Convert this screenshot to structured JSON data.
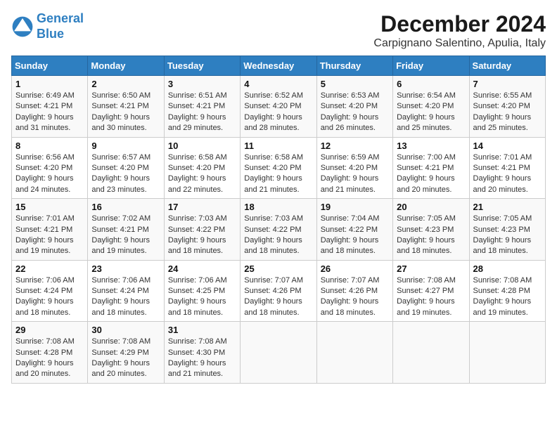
{
  "logo": {
    "line1": "General",
    "line2": "Blue"
  },
  "title": "December 2024",
  "subtitle": "Carpignano Salentino, Apulia, Italy",
  "weekdays": [
    "Sunday",
    "Monday",
    "Tuesday",
    "Wednesday",
    "Thursday",
    "Friday",
    "Saturday"
  ],
  "weeks": [
    [
      {
        "day": 1,
        "rise": "6:49 AM",
        "set": "4:21 PM",
        "daylight": "9 hours and 31 minutes."
      },
      {
        "day": 2,
        "rise": "6:50 AM",
        "set": "4:21 PM",
        "daylight": "9 hours and 30 minutes."
      },
      {
        "day": 3,
        "rise": "6:51 AM",
        "set": "4:21 PM",
        "daylight": "9 hours and 29 minutes."
      },
      {
        "day": 4,
        "rise": "6:52 AM",
        "set": "4:20 PM",
        "daylight": "9 hours and 28 minutes."
      },
      {
        "day": 5,
        "rise": "6:53 AM",
        "set": "4:20 PM",
        "daylight": "9 hours and 26 minutes."
      },
      {
        "day": 6,
        "rise": "6:54 AM",
        "set": "4:20 PM",
        "daylight": "9 hours and 25 minutes."
      },
      {
        "day": 7,
        "rise": "6:55 AM",
        "set": "4:20 PM",
        "daylight": "9 hours and 25 minutes."
      }
    ],
    [
      {
        "day": 8,
        "rise": "6:56 AM",
        "set": "4:20 PM",
        "daylight": "9 hours and 24 minutes."
      },
      {
        "day": 9,
        "rise": "6:57 AM",
        "set": "4:20 PM",
        "daylight": "9 hours and 23 minutes."
      },
      {
        "day": 10,
        "rise": "6:58 AM",
        "set": "4:20 PM",
        "daylight": "9 hours and 22 minutes."
      },
      {
        "day": 11,
        "rise": "6:58 AM",
        "set": "4:20 PM",
        "daylight": "9 hours and 21 minutes."
      },
      {
        "day": 12,
        "rise": "6:59 AM",
        "set": "4:20 PM",
        "daylight": "9 hours and 21 minutes."
      },
      {
        "day": 13,
        "rise": "7:00 AM",
        "set": "4:21 PM",
        "daylight": "9 hours and 20 minutes."
      },
      {
        "day": 14,
        "rise": "7:01 AM",
        "set": "4:21 PM",
        "daylight": "9 hours and 20 minutes."
      }
    ],
    [
      {
        "day": 15,
        "rise": "7:01 AM",
        "set": "4:21 PM",
        "daylight": "9 hours and 19 minutes."
      },
      {
        "day": 16,
        "rise": "7:02 AM",
        "set": "4:21 PM",
        "daylight": "9 hours and 19 minutes."
      },
      {
        "day": 17,
        "rise": "7:03 AM",
        "set": "4:22 PM",
        "daylight": "9 hours and 18 minutes."
      },
      {
        "day": 18,
        "rise": "7:03 AM",
        "set": "4:22 PM",
        "daylight": "9 hours and 18 minutes."
      },
      {
        "day": 19,
        "rise": "7:04 AM",
        "set": "4:22 PM",
        "daylight": "9 hours and 18 minutes."
      },
      {
        "day": 20,
        "rise": "7:05 AM",
        "set": "4:23 PM",
        "daylight": "9 hours and 18 minutes."
      },
      {
        "day": 21,
        "rise": "7:05 AM",
        "set": "4:23 PM",
        "daylight": "9 hours and 18 minutes."
      }
    ],
    [
      {
        "day": 22,
        "rise": "7:06 AM",
        "set": "4:24 PM",
        "daylight": "9 hours and 18 minutes."
      },
      {
        "day": 23,
        "rise": "7:06 AM",
        "set": "4:24 PM",
        "daylight": "9 hours and 18 minutes."
      },
      {
        "day": 24,
        "rise": "7:06 AM",
        "set": "4:25 PM",
        "daylight": "9 hours and 18 minutes."
      },
      {
        "day": 25,
        "rise": "7:07 AM",
        "set": "4:26 PM",
        "daylight": "9 hours and 18 minutes."
      },
      {
        "day": 26,
        "rise": "7:07 AM",
        "set": "4:26 PM",
        "daylight": "9 hours and 18 minutes."
      },
      {
        "day": 27,
        "rise": "7:08 AM",
        "set": "4:27 PM",
        "daylight": "9 hours and 19 minutes."
      },
      {
        "day": 28,
        "rise": "7:08 AM",
        "set": "4:28 PM",
        "daylight": "9 hours and 19 minutes."
      }
    ],
    [
      {
        "day": 29,
        "rise": "7:08 AM",
        "set": "4:28 PM",
        "daylight": "9 hours and 20 minutes."
      },
      {
        "day": 30,
        "rise": "7:08 AM",
        "set": "4:29 PM",
        "daylight": "9 hours and 20 minutes."
      },
      {
        "day": 31,
        "rise": "7:08 AM",
        "set": "4:30 PM",
        "daylight": "9 hours and 21 minutes."
      },
      null,
      null,
      null,
      null
    ]
  ],
  "labels": {
    "sunrise": "Sunrise:",
    "sunset": "Sunset:",
    "daylight": "Daylight:"
  }
}
